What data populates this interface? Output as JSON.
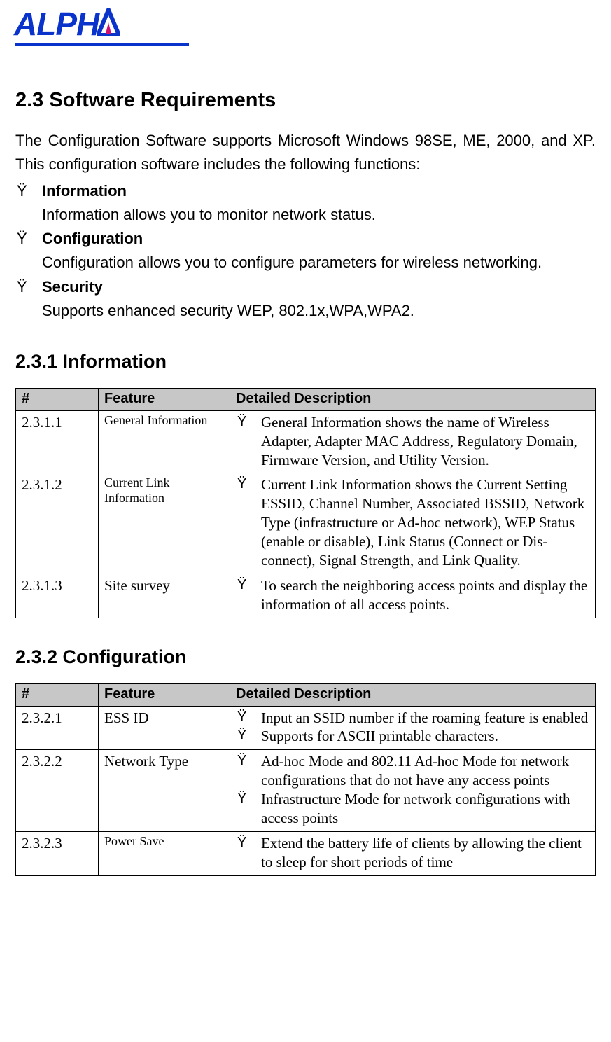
{
  "logo": {
    "text_left": "ALPH",
    "text_right": ""
  },
  "section_heading": "2.3 Software Requirements",
  "intro_para": "The Configuration Software supports Microsoft Windows 98SE, ME, 2000, and XP. This configuration software includes the following functions:",
  "bullets": [
    {
      "title": "Information",
      "body": "Information allows you to monitor network status."
    },
    {
      "title": "Configuration",
      "body": "Configuration allows you to configure parameters for wireless networking."
    },
    {
      "title": "Security",
      "body": "Supports enhanced security WEP, 802.1x,WPA,WPA2."
    }
  ],
  "subA_heading": "2.3.1 Information",
  "tableA": {
    "headers": {
      "num": "#",
      "feature": "Feature",
      "desc": "Detailed Description"
    },
    "rows": [
      {
        "num": "2.3.1.1",
        "feature": "General Information",
        "feat_size": "sm",
        "items": [
          "General Information shows the name of Wireless Adapter, Adapter MAC Address, Regulatory Domain, Firmware Version, and Utility Version."
        ]
      },
      {
        "num": "2.3.1.2",
        "feature": "Current Link Information",
        "feat_size": "sm",
        "items": [
          "Current Link Information shows the Current Setting ESSID, Channel Number, Associated BSSID, Network Type (infrastructure or Ad-hoc network), WEP Status (enable or disable), Link Status (Connect or Dis-connect), Signal Strength, and Link Quality."
        ]
      },
      {
        "num": "2.3.1.3",
        "feature": "Site survey",
        "feat_size": "lg",
        "items": [
          "To search the neighboring access points and display the information of all access points."
        ]
      }
    ]
  },
  "subB_heading": "2.3.2 Configuration",
  "tableB": {
    "headers": {
      "num": "#",
      "feature": "Feature",
      "desc": "Detailed Description"
    },
    "rows": [
      {
        "num": "2.3.2.1",
        "feature": "ESS ID",
        "feat_size": "lg",
        "items": [
          "Input an SSID number if the roaming feature is enabled",
          "Supports for ASCII printable characters."
        ]
      },
      {
        "num": "2.3.2.2",
        "feature": "Network Type",
        "feat_size": "lg",
        "items": [
          "Ad-hoc Mode and 802.11 Ad-hoc Mode for network configurations that do not have any access points",
          "Infrastructure Mode for network configurations with access points"
        ]
      },
      {
        "num": "2.3.2.3",
        "feature": "Power Save",
        "feat_size": "sm",
        "items": [
          "Extend the battery life of clients by allowing the client to sleep for short periods of time"
        ]
      }
    ]
  }
}
